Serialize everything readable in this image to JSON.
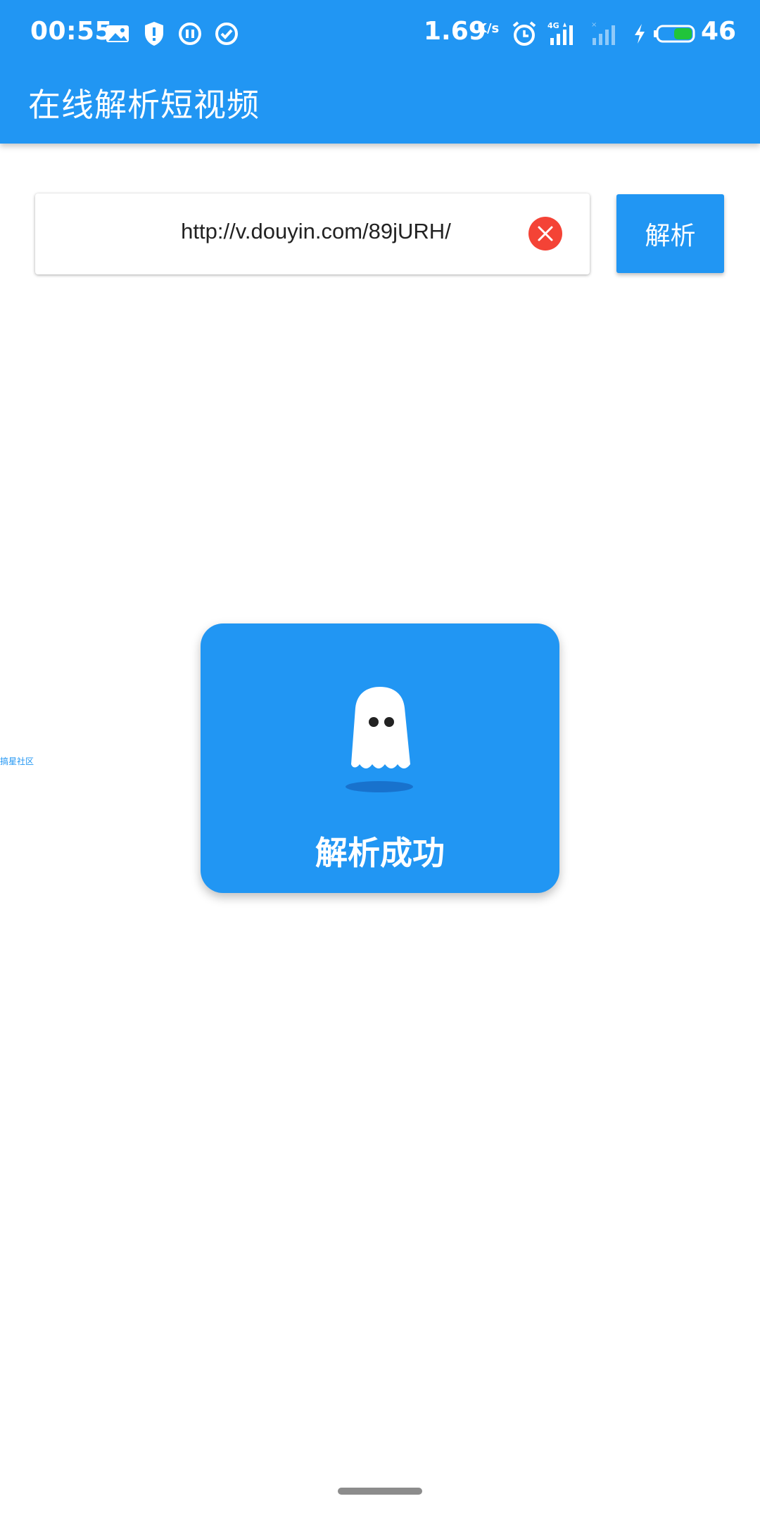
{
  "status_bar": {
    "time": "00:55",
    "network_speed": "1.69",
    "network_speed_unit": "K/s",
    "battery_percent": "46",
    "icons": [
      "gallery-icon",
      "shield-alert-icon",
      "pause-circle-icon",
      "check-circle-icon",
      "alarm-icon",
      "signal-4g-icon",
      "signal-weak-icon",
      "charging-icon",
      "battery-icon"
    ]
  },
  "app_bar": {
    "title": "在线解析短视频"
  },
  "url_input": {
    "value": "http://v.douyin.com/89jURH/",
    "clear_icon": "close-icon"
  },
  "parse_button": {
    "label": "解析"
  },
  "watermark": {
    "text": "搞星社区"
  },
  "toast": {
    "message": "解析成功",
    "icon": "ghost-icon"
  },
  "colors": {
    "primary": "#2196F3",
    "danger": "#F44336",
    "battery_fill": "#21C43A"
  }
}
